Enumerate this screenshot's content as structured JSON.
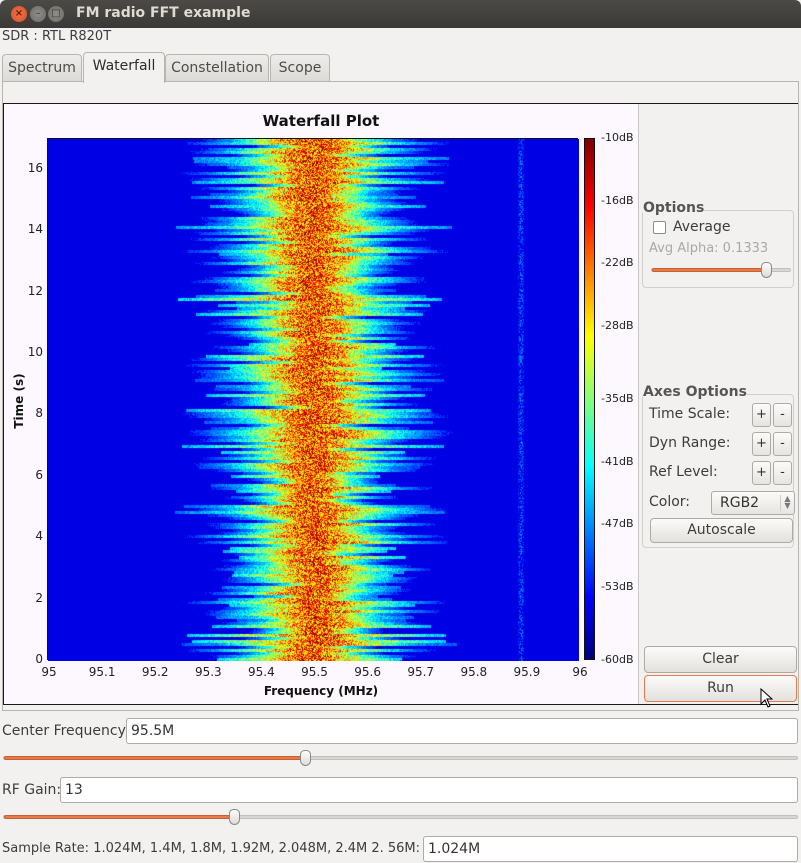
{
  "window": {
    "title": "FM radio FFT example",
    "controls": {
      "close": "×",
      "minimize": "–",
      "maximize": "□"
    }
  },
  "device_label": "SDR : RTL R820T",
  "tabs": [
    {
      "label": "Spectrum",
      "active": false
    },
    {
      "label": "Waterfall",
      "active": true
    },
    {
      "label": "Constellation",
      "active": false
    },
    {
      "label": "Scope",
      "active": false
    }
  ],
  "plot": {
    "title": "Waterfall Plot",
    "xlabel": "Frequency (MHz)",
    "ylabel": "Time (s)",
    "xticks": [
      "95",
      "95.1",
      "95.2",
      "95.3",
      "95.4",
      "95.5",
      "95.6",
      "95.7",
      "95.8",
      "95.9",
      "96"
    ],
    "yticks": [
      "0",
      "2",
      "4",
      "6",
      "8",
      "10",
      "12",
      "14",
      "16"
    ],
    "colorbar_ticks": [
      "-10dB",
      "-16dB",
      "-22dB",
      "-28dB",
      "-35dB",
      "-41dB",
      "-47dB",
      "-53dB",
      "-60dB"
    ]
  },
  "chart_data": {
    "type": "heatmap",
    "title": "Waterfall Plot",
    "xlabel": "Frequency (MHz)",
    "ylabel": "Time (s)",
    "xlim": [
      95,
      96
    ],
    "ylim": [
      0,
      17
    ],
    "x_ticks": [
      95,
      95.1,
      95.2,
      95.3,
      95.4,
      95.5,
      95.6,
      95.7,
      95.8,
      95.9,
      96
    ],
    "y_ticks": [
      0,
      2,
      4,
      6,
      8,
      10,
      12,
      14,
      16
    ],
    "colorbar": {
      "label_unit": "dB",
      "range": [
        -60,
        -10
      ],
      "ticks": [
        -10,
        -16,
        -22,
        -28,
        -35,
        -41,
        -47,
        -53,
        -60
      ],
      "colormap": "jet"
    },
    "features": [
      {
        "name": "main FM carrier",
        "center_mhz": 95.5,
        "bandwidth_mhz": 0.25,
        "peak_db": -16
      },
      {
        "name": "weak signal",
        "center_mhz": 95.89,
        "bandwidth_mhz": 0.02,
        "peak_db": -53
      }
    ],
    "noise_floor_db": -60
  },
  "options": {
    "title": "Options",
    "average_label": "Average",
    "average_checked": false,
    "avg_alpha_label": "Avg Alpha: 0.1333",
    "avg_alpha_value": 0.1333,
    "avg_alpha_slider_fraction": 0.82
  },
  "axes_options": {
    "title": "Axes Options",
    "time_scale_label": "Time Scale:",
    "dyn_range_label": "Dyn Range:",
    "ref_level_label": "Ref Level:",
    "plus": "+",
    "minus": "-",
    "color_label": "Color:",
    "color_value": "RGB2",
    "autoscale_label": "Autoscale"
  },
  "buttons": {
    "clear": "Clear",
    "run": "Run"
  },
  "controls": {
    "center_frequency_label": "Center Frequency:",
    "center_frequency_value": "95.5M",
    "center_frequency_slider_fraction": 0.38,
    "rf_gain_label": "RF Gain:",
    "rf_gain_value": "13",
    "rf_gain_slider_fraction": 0.29,
    "sample_rate_label": "Sample Rate: 1.024M, 1.4M, 1.8M, 1.92M, 2.048M, 2.4M  2. 56M:",
    "sample_rate_value": "1.024M"
  }
}
